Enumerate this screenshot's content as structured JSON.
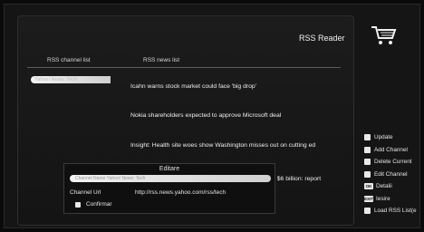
{
  "header": {
    "title": "RSS Reader",
    "cart_icon": "cart-icon"
  },
  "lists": {
    "channel_header": "RSS channel list",
    "news_header": "RSS news list",
    "selected_channel": "Yahoo! News: Tech"
  },
  "news": [
    "Icahn warns stock market could face 'big drop'",
    "Nokia shareholders expected to approve Microsoft deal",
    "Insight: Health site woes show Washington misses out on cutting ed",
    "t $6 billion: report"
  ],
  "sidebar": {
    "items": [
      {
        "label": "Update",
        "icon": "checkbox-icon"
      },
      {
        "label": "Add Channel",
        "icon": "checkbox-icon"
      },
      {
        "label": "Delete Current",
        "icon": "checkbox-icon"
      },
      {
        "label": "Edit Channel",
        "icon": "checkbox-icon"
      },
      {
        "label": "Detalii",
        "key": "OK"
      },
      {
        "label": "Iesire",
        "key": "EXIT"
      },
      {
        "label": "Load RSS List(e",
        "icon": "checkbox-icon"
      }
    ]
  },
  "dialog": {
    "title": "Editare",
    "name_row": "Channel Name   Yahoo! News: Tech",
    "url_label": "Channel Url",
    "url_value": "http://rss.news.yahoo.com/rss/tech",
    "confirm_label": "Confirmar"
  }
}
